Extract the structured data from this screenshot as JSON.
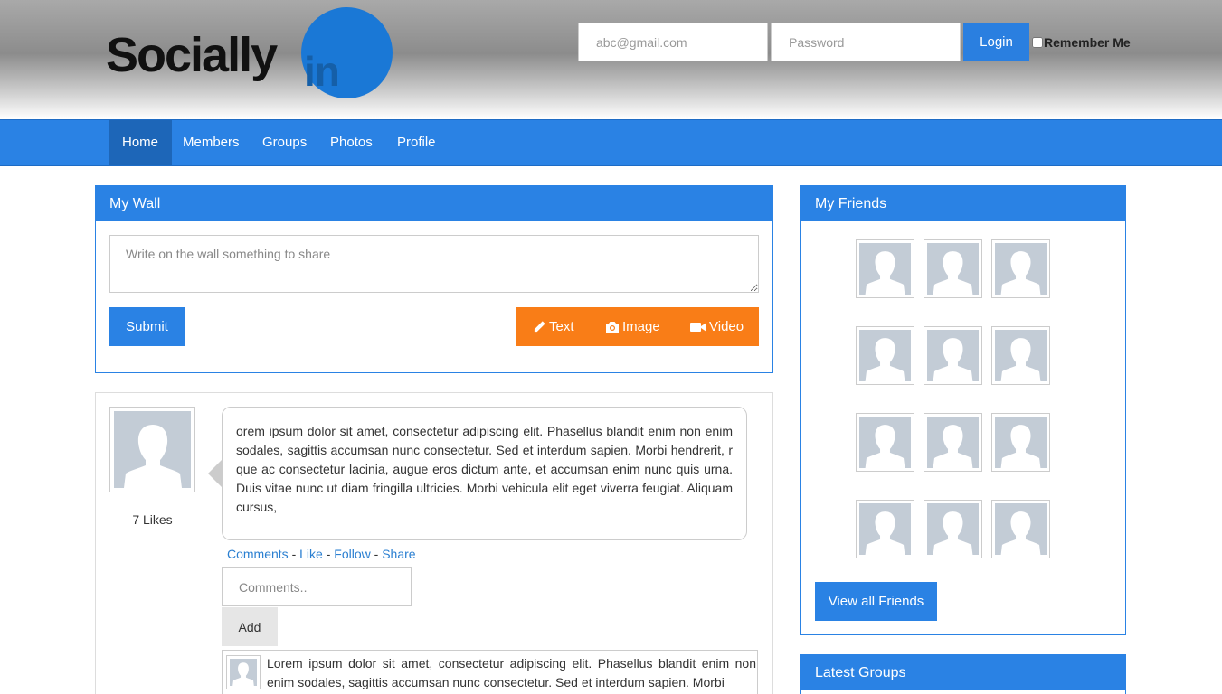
{
  "brand": {
    "name_main": "Socially",
    "name_in": "in"
  },
  "login": {
    "email_placeholder": "abc@gmail.com",
    "password_placeholder": "Password",
    "login_label": "Login",
    "remember_label": "Remember Me"
  },
  "nav": {
    "items": [
      {
        "label": "Home",
        "active": true
      },
      {
        "label": "Members"
      },
      {
        "label": "Groups"
      },
      {
        "label": "Photos"
      },
      {
        "label": "Profile"
      }
    ]
  },
  "wall": {
    "title": "My Wall",
    "placeholder": "Write on the wall something to share",
    "submit_label": "Submit",
    "media": {
      "text": "Text",
      "image": "Image",
      "video": "Video"
    }
  },
  "post": {
    "likes": "7 Likes",
    "body": "orem ipsum dolor sit amet, consectetur adipiscing elit. Phasellus blandit enim non enim sodales, sagittis accumsan nunc consectetur. Sed et interdum sapien. Morbi hendrerit, r que ac consectetur lacinia, augue eros dictum ante, et accumsan enim nunc quis urna. Duis vitae nunc ut diam fringilla ultricies. Morbi vehicula elit eget viverra feugiat. Aliquam cursus,",
    "actions": {
      "comments": "Comments",
      "like": "Like",
      "follow": "Follow",
      "share": "Share",
      "separator": "-"
    },
    "comment_placeholder": "Comments..",
    "add_label": "Add",
    "comment": "Lorem ipsum dolor sit amet, consectetur adipiscing elit. Phasellus blandit enim non enim sodales, sagittis accumsan nunc consectetur. Sed et interdum sapien. Morbi"
  },
  "friends": {
    "title": "My Friends",
    "count": 12,
    "view_all_label": "View all Friends"
  },
  "groups": {
    "title": "Latest Groups"
  },
  "colors": {
    "primary": "#2a82e4",
    "nav_active": "#1d66b8",
    "accent": "#f97d17",
    "link": "#2a7fd1"
  }
}
